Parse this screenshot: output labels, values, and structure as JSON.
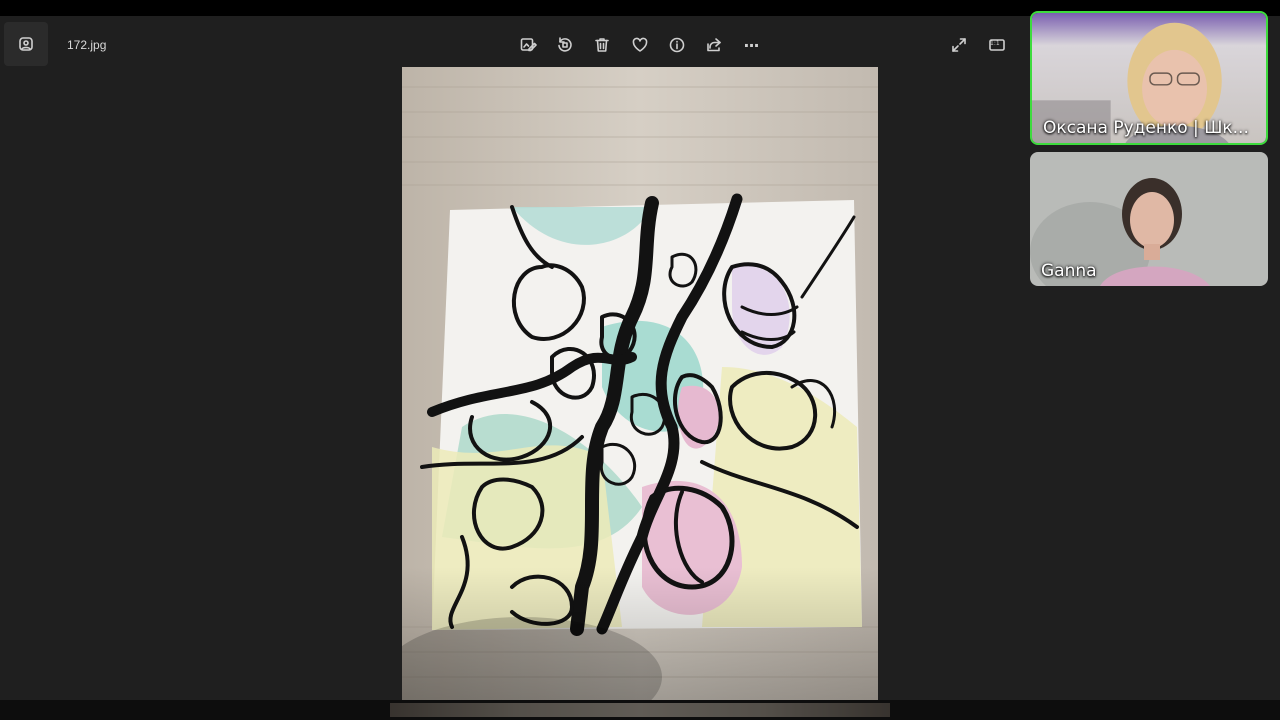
{
  "viewer": {
    "filename": "172.jpg",
    "toolbar": {
      "edit_icon": "edit-image-icon",
      "rotate_icon": "rotate-icon",
      "delete_icon": "trash-icon",
      "favorite_icon": "heart-icon",
      "info_icon": "info-icon",
      "share_icon": "share-icon",
      "more_icon": "more-icon",
      "more_label": "···",
      "fullscreen_icon": "expand-icon",
      "actual_size_label": "1:1"
    }
  },
  "participants": [
    {
      "name": "Оксана Руденко | Шк...",
      "active": true
    },
    {
      "name": "Ganna",
      "active": false
    }
  ],
  "colors": {
    "viewer_bg": "#1f1f1f",
    "active_speaker_border": "#3ddc3d",
    "icon_color": "#cfcfcf"
  }
}
